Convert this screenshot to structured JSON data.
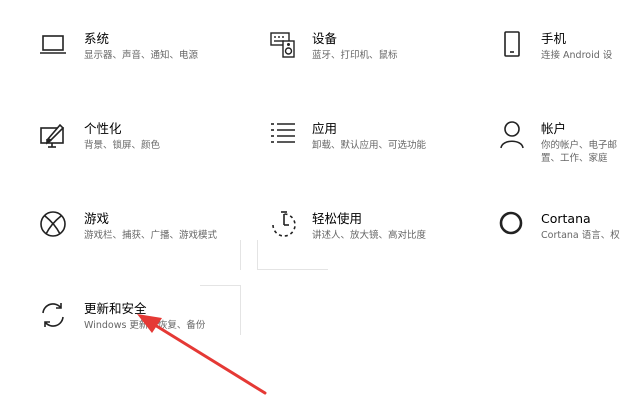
{
  "tiles": [
    {
      "title": "系统",
      "desc": "显示器、声音、通知、电源",
      "icon": "monitor-icon"
    },
    {
      "title": "设备",
      "desc": "蓝牙、打印机、鼠标",
      "icon": "keyboard-speaker-icon"
    },
    {
      "title": "手机",
      "desc": "连接 Android 设",
      "icon": "phone-icon"
    },
    {
      "title": "个性化",
      "desc": "背景、锁屏、颜色",
      "icon": "paintbrush-icon"
    },
    {
      "title": "应用",
      "desc": "卸载、默认应用、可选功能",
      "icon": "apps-list-icon"
    },
    {
      "title": "帐户",
      "desc_line1": "你的帐户、电子邮",
      "desc_line2": "置、工作、家庭",
      "icon": "person-icon"
    },
    {
      "title": "游戏",
      "desc": "游戏栏、捕获、广播、游戏模式",
      "icon": "xbox-icon"
    },
    {
      "title": "轻松使用",
      "desc": "讲述人、放大镜、高对比度",
      "icon": "ease-of-access-timer-icon"
    },
    {
      "title": "Cortana",
      "desc": "Cortana 语言、权",
      "icon": "cortana-ring-icon"
    },
    {
      "title": "更新和安全",
      "desc": "Windows 更新、恢复、备份",
      "icon": "sync-arrows-icon"
    }
  ],
  "colors": {
    "background": "#ffffff",
    "text": "#000000",
    "secondary_text": "#666666",
    "annotation_arrow": "#e53935"
  }
}
